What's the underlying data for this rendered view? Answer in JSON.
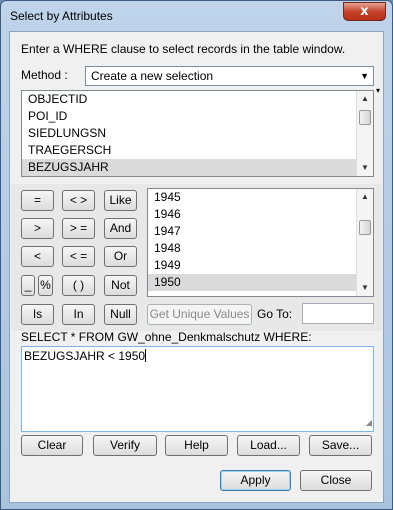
{
  "window": {
    "title": "Select by Attributes",
    "close_glyph": "x"
  },
  "instructions": "Enter a WHERE clause to select records in the table window.",
  "method": {
    "label": "Method :",
    "selected": "Create a new selection"
  },
  "fields": {
    "items": [
      "OBJECTID",
      "POI_ID",
      "SIEDLUNGSN",
      "TRAEGERSCH",
      "BEZUGSJAHR"
    ],
    "selected": "BEZUGSJAHR"
  },
  "operators": {
    "eq": "=",
    "ne": "< >",
    "like": "Like",
    "gt": ">",
    "ge": "> =",
    "and": "And",
    "lt": "<",
    "le": "< =",
    "or": "Or",
    "underscore": "_",
    "percent": "%",
    "parens": "( )",
    "not": "Not",
    "is": "Is",
    "in": "In",
    "null": "Null"
  },
  "values": {
    "items": [
      "1945",
      "1946",
      "1947",
      "1948",
      "1949",
      "1950"
    ],
    "selected": "1950"
  },
  "get_unique_values": "Get Unique Values",
  "go_to_label": "Go To:",
  "go_to_value": "",
  "sql_prefix": "SELECT * FROM GW_ohne_Denkmalschutz WHERE:",
  "expression": "BEZUGSJAHR < 1950",
  "buttons": {
    "clear": "Clear",
    "verify": "Verify",
    "help": "Help",
    "load": "Load...",
    "save": "Save...",
    "apply": "Apply",
    "close": "Close"
  }
}
